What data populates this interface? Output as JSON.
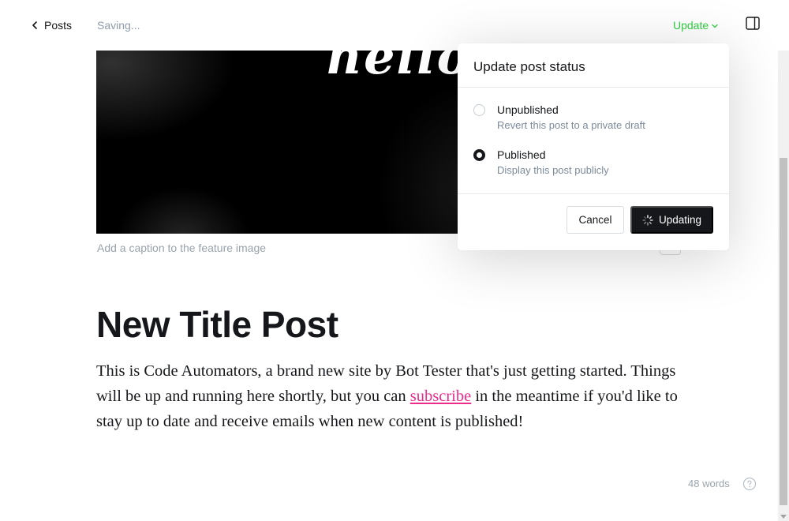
{
  "header": {
    "back_label": "Posts",
    "status_text": "Saving...",
    "update_label": "Update"
  },
  "editor": {
    "feature_image_text": "hello",
    "caption_placeholder": "Add a caption to the feature image",
    "title": "New Title Post",
    "body_before_link": "This is Code Automators, a brand new site by Bot Tester that's just getting started. Things will be up and running here shortly, but you can ",
    "body_link": "subscribe",
    "body_after_link": " in the meantime if you'd like to stay up to date and receive emails when new content is published!",
    "word_count": "48 words"
  },
  "status_popup": {
    "title": "Update post status",
    "options": [
      {
        "label": "Unpublished",
        "description": "Revert this post to a private draft",
        "selected": false
      },
      {
        "label": "Published",
        "description": "Display this post publicly",
        "selected": true
      }
    ],
    "cancel_label": "Cancel",
    "confirm_label": "Updating"
  },
  "colors": {
    "accent_green": "#30cf43",
    "link_pink": "#ed2b8b",
    "dark": "#15171a",
    "muted": "#99a3ad"
  },
  "icons": {
    "back": "chevron-left-icon",
    "update_caret": "chevron-down-icon",
    "sidebar": "sidebar-toggle-icon",
    "help": "question-circle-icon",
    "spinner": "spinner-icon"
  }
}
